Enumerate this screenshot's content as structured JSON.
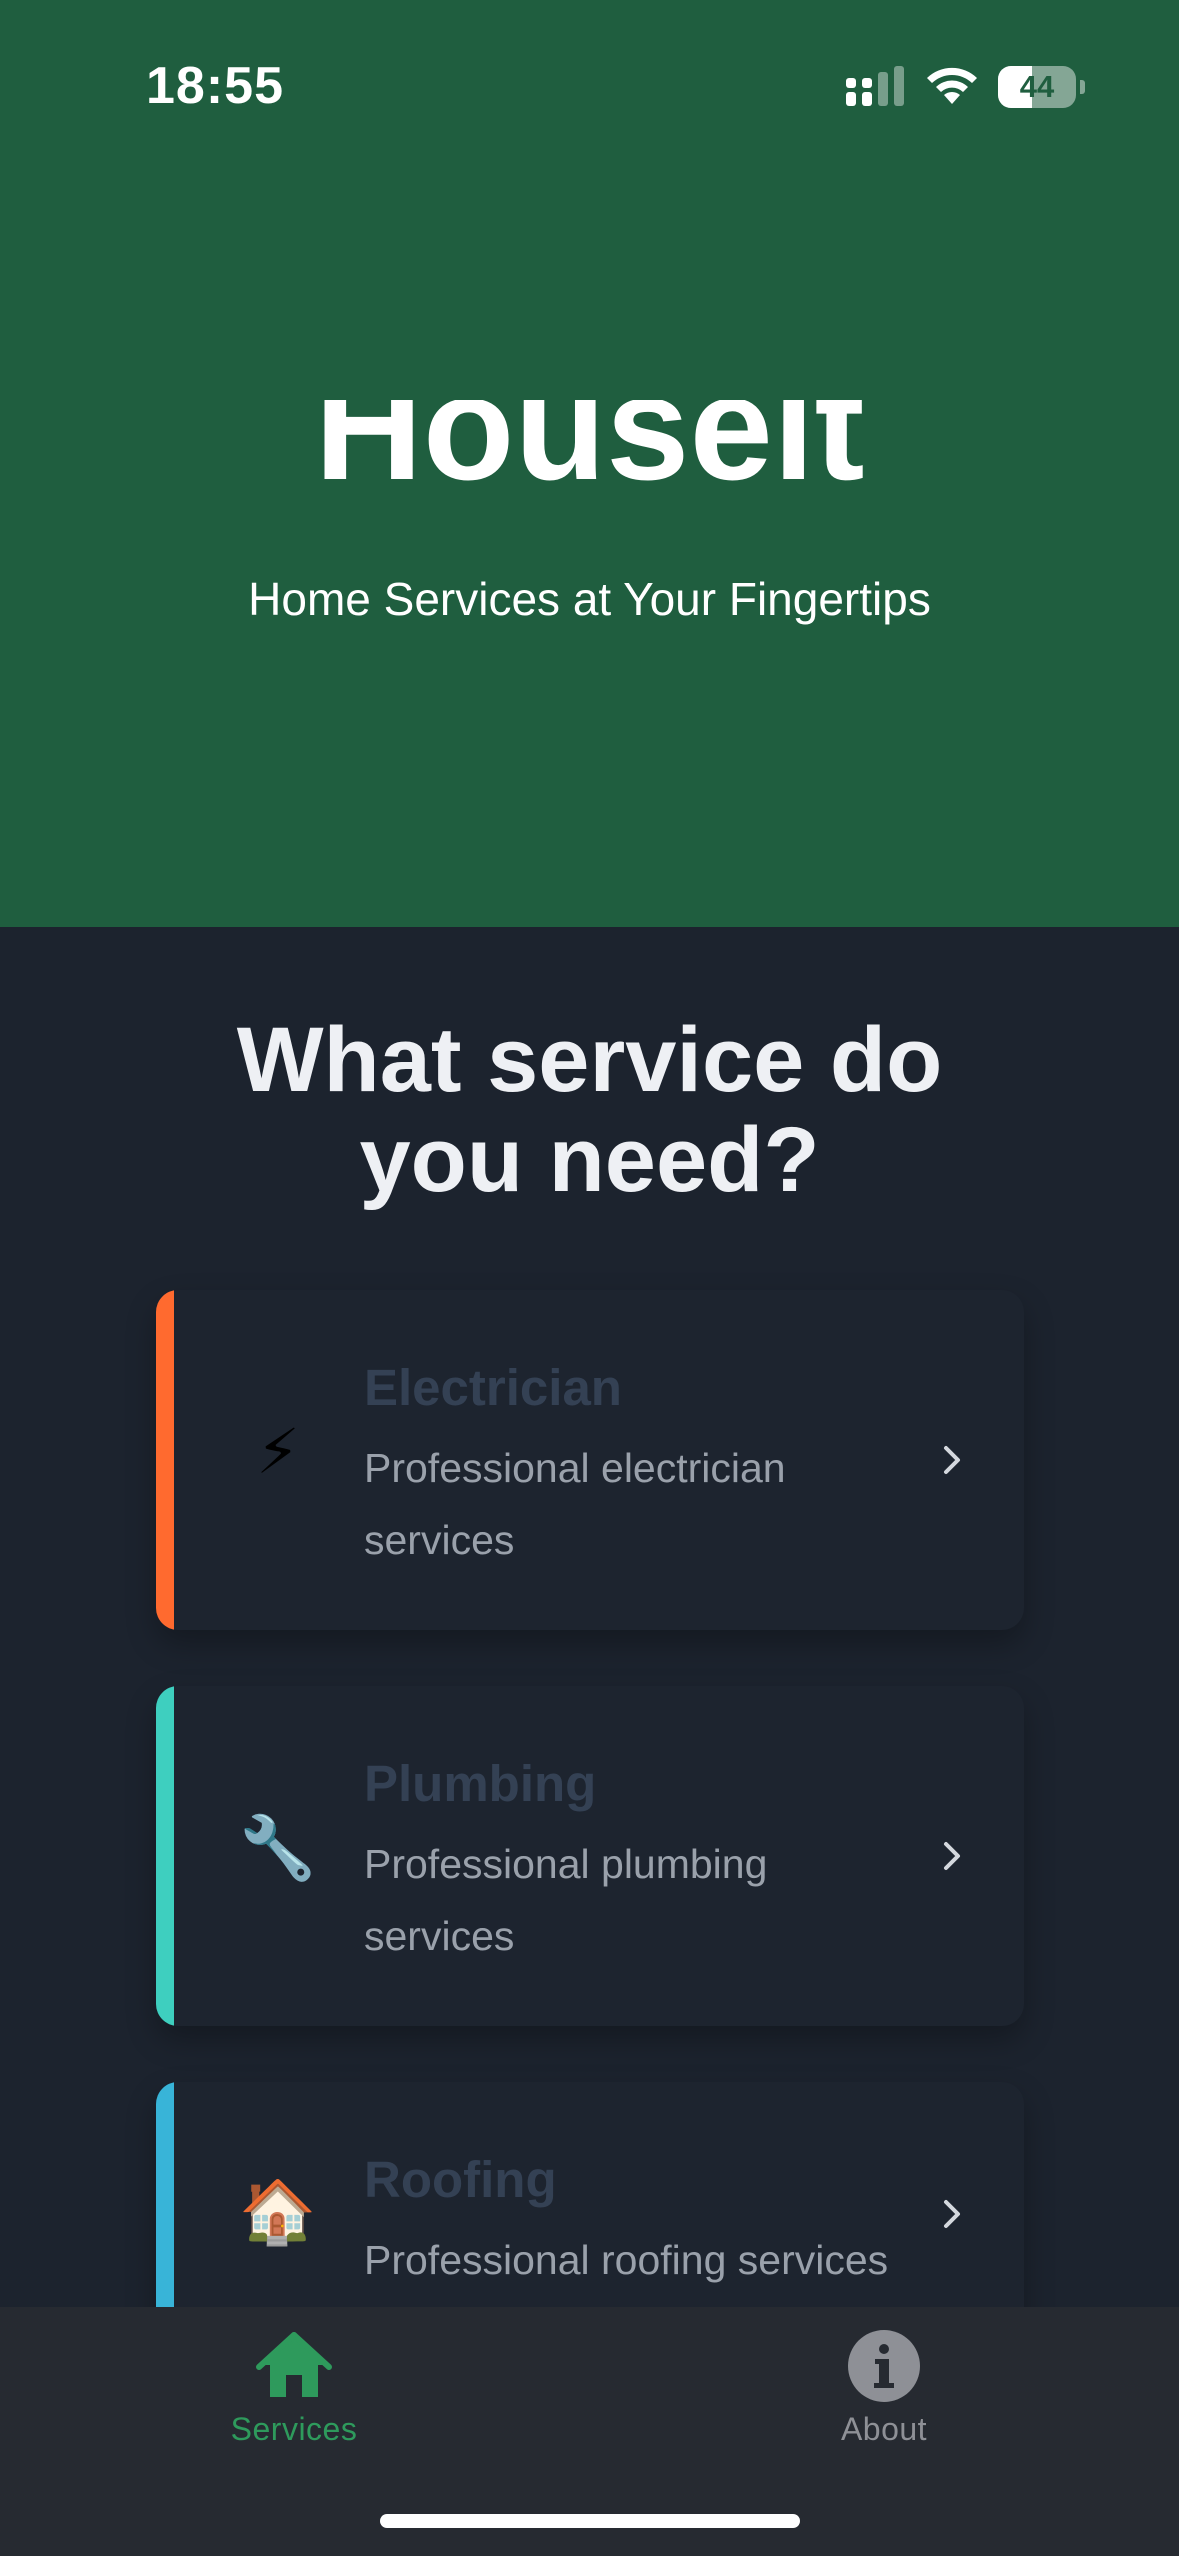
{
  "status_bar": {
    "time": "18:55",
    "battery": "44",
    "battery_level_percent": 44
  },
  "header": {
    "app_title": "Houseit",
    "tagline": "Home Services at Your Fingertips",
    "background_color": "#1f5e3f"
  },
  "main": {
    "heading": "What service do you need?",
    "services": [
      {
        "title": "Electrician",
        "description": "Professional electrician services",
        "icon": "lightning-icon",
        "icon_glyph": "⚡",
        "accent_color": "#ff6a2f"
      },
      {
        "title": "Plumbing",
        "description": "Professional plumbing services",
        "icon": "wrench-icon",
        "icon_glyph": "🔧",
        "accent_color": "#3ecfbf"
      },
      {
        "title": "Roofing",
        "description": "Professional roofing services",
        "icon": "house-icon",
        "icon_glyph": "🏠",
        "accent_color": "#38b4d8"
      }
    ]
  },
  "tab_bar": {
    "tabs": [
      {
        "label": "Services",
        "icon": "home-icon",
        "active": true,
        "color": "#2e9a5c"
      },
      {
        "label": "About",
        "icon": "info-icon",
        "active": false,
        "color": "#8e9096"
      }
    ]
  }
}
